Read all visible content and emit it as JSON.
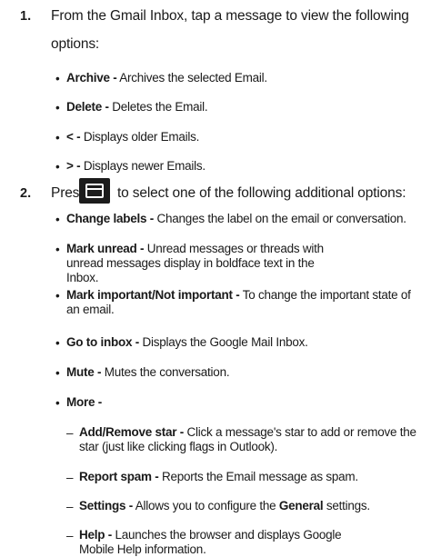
{
  "steps": [
    {
      "number": "1.",
      "text_line1": "From the Gmail Inbox, tap a message to view the following",
      "text_line2": "options:"
    },
    {
      "number": "2.",
      "text_before": "Press",
      "icon": "menu-key-icon",
      "text_after": "to select one of the following additional options:"
    }
  ],
  "step1_items": [
    {
      "label": "Archive -",
      "desc": " Archives the selected Email."
    },
    {
      "label": "Delete -",
      "desc": " Deletes the Email."
    },
    {
      "label": "< -",
      "desc": " Displays older Emails."
    },
    {
      "label": "> -",
      "desc": " Displays newer Emails."
    }
  ],
  "step2_items": [
    {
      "label": "Change labels -",
      "desc": " Changes the label on the email or conversation."
    },
    {
      "label": "Mark unread -",
      "desc": " Unread messages or threads with unread messages display in boldface text in the Inbox."
    },
    {
      "label": "Mark important/Not important -",
      "desc": " To change the important state of an email."
    },
    {
      "label": "Go to inbox -",
      "desc": " Displays the Google Mail Inbox."
    },
    {
      "label": "Mute -",
      "desc": " Mutes the conversation."
    },
    {
      "label": "More -",
      "desc": ""
    }
  ],
  "more_items": [
    {
      "label": "Add/Remove star -",
      "desc": " Click a message's star to add or remove the star (just like clicking flags in Outlook)."
    },
    {
      "label": "Report spam -",
      "desc": " Reports the Email message as spam."
    },
    {
      "label": "Settings -",
      "desc_before": " Allows you to configure the ",
      "desc_bold": "General",
      "desc_after": " settings."
    },
    {
      "label": "Help -",
      "desc": " Launches the browser and displays Google Mobile Help information."
    }
  ],
  "bullet_char": "•",
  "dash_char": "–"
}
